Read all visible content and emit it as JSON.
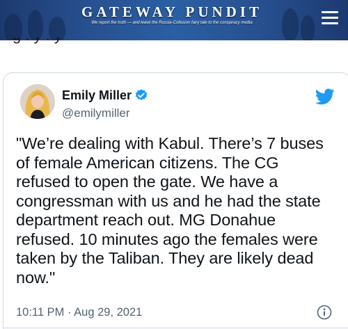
{
  "site_header": {
    "logo_text": "GATEWAY PUNDIT",
    "tagline": "We report the truth — and leave the Russia-Collusion fairy tale to the conspiracy media",
    "menu_icon": "hamburger-menu-icon"
  },
  "article": {
    "cutoff_text": "g  .  y   .   y"
  },
  "tweet": {
    "author_name": "Emily Miller",
    "author_handle": "@emilymiller",
    "verified_icon": "verified-badge-icon",
    "platform_icon": "twitter-bird-icon",
    "body_lines": [
      "\"We’re dealing with Kabul. There’s 7 buses",
      "of female American citizens. The CG",
      "refused to open the gate. We have a",
      "congressman with us and he had the state",
      "department reach out. MG Donahue",
      "refused. 10 minutes ago the females were",
      "taken by the Taliban. They are likely dead",
      "now.\""
    ],
    "timestamp": "10:11 PM · Aug 29, 2021",
    "info_icon": "info-icon"
  },
  "colors": {
    "banner_blue": "#27508f",
    "twitter_blue": "#1d9bf0",
    "text_primary": "#0f1419",
    "text_secondary": "#536471",
    "border": "#cfd9de"
  }
}
